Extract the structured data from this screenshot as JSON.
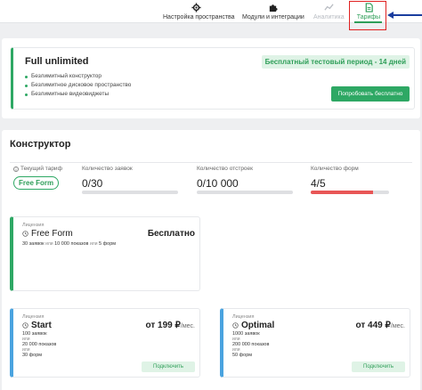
{
  "nav": {
    "tabs": [
      {
        "label": "Настройка пространства",
        "icon": "gear-icon"
      },
      {
        "label": "Модули и интеграции",
        "icon": "puzzle-icon"
      },
      {
        "label": "Аналитика",
        "icon": "chart-line-icon"
      },
      {
        "label": "Тарифы",
        "icon": "document-icon",
        "active": true
      }
    ],
    "accent_color": "#2e9e58"
  },
  "full_unlimited": {
    "title": "Full unlimited",
    "features": [
      "Безлимитный конструктор",
      "Безлимитное дисковое пространство",
      "Безлимитные видеовиджеты"
    ],
    "trial_badge": "Бесплатный тестовый период - 14 дней",
    "try_button": "Попробовать бесплатно"
  },
  "constructor": {
    "title": "Конструктор",
    "current_tariff_label": "Текущий тариф",
    "current_tariff": "Free Form",
    "stats": [
      {
        "label": "Количество заявок",
        "value": "0/30",
        "progress": 0
      },
      {
        "label": "Количество отстроек",
        "value": "0/10 000",
        "progress": 0
      },
      {
        "label": "Количество форм",
        "value": "4/5",
        "progress": 0.8
      }
    ]
  },
  "plans": {
    "free": {
      "license_label": "Лицензия",
      "name": "Free Form",
      "price": "Бесплатно",
      "desc_a": "30 заявок",
      "or1": "или",
      "desc_b": "10 000 показов",
      "or2": "или",
      "desc_c": "5 форм"
    },
    "start": {
      "license_label": "Лицензия",
      "name": "Start",
      "price": "от 199 ₽",
      "per": "/мес.",
      "line1": "100 заявок",
      "or1": "или",
      "line2": "20 000 показов",
      "or2": "или",
      "line3": "30 форм",
      "button": "Подключить"
    },
    "optimal": {
      "license_label": "Лицензия",
      "name": "Optimal",
      "price": "от 449 ₽",
      "per": "/мес.",
      "line1": "1000 заявок",
      "or1": "или",
      "line2": "200 000 показов",
      "or2": "или",
      "line3": "50 форм",
      "button": "Подключить"
    }
  }
}
